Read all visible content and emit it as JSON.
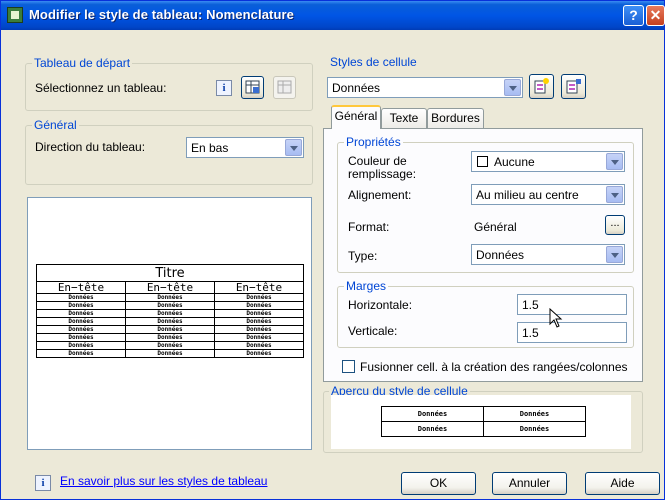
{
  "window": {
    "title": "Modifier le style de tableau: Nomenclature",
    "help": "?",
    "close": "✕"
  },
  "tableau_depart": {
    "legend": "Tableau de départ",
    "label": "Sélectionnez un tableau:"
  },
  "general": {
    "legend": "Général",
    "label": "Direction du tableau:",
    "direction": "En bas"
  },
  "preview_table": {
    "title": "Titre",
    "headers": [
      "En−tête",
      "En−tête",
      "En−tête"
    ],
    "cell": "Données",
    "rows": 8
  },
  "styles_cellule": {
    "legend": "Styles de cellule",
    "value": "Données"
  },
  "tabs": [
    "Général",
    "Texte",
    "Bordures"
  ],
  "proprietes": {
    "legend": "Propriétés",
    "couleur_label": "Couleur de remplissage:",
    "couleur_value": "Aucune",
    "alignement_label": "Alignement:",
    "alignement_value": "Au milieu au centre",
    "format_label": "Format:",
    "format_value": "Général",
    "format_button": "...",
    "type_label": "Type:",
    "type_value": "Données"
  },
  "marges": {
    "legend": "Marges",
    "horizontale_label": "Horizontale:",
    "horizontale_value": "1.5",
    "verticale_label": "Verticale:",
    "verticale_value": "1.5"
  },
  "fusion_label": "Fusionner cell. à la création des rangées/colonnes",
  "apercu": {
    "legend": "Aperçu du style de cellule",
    "cell": "Données"
  },
  "footer": {
    "info_icon": "i",
    "link": "En savoir plus sur les styles de tableau",
    "ok": "OK",
    "annuler": "Annuler",
    "aide": "Aide"
  }
}
